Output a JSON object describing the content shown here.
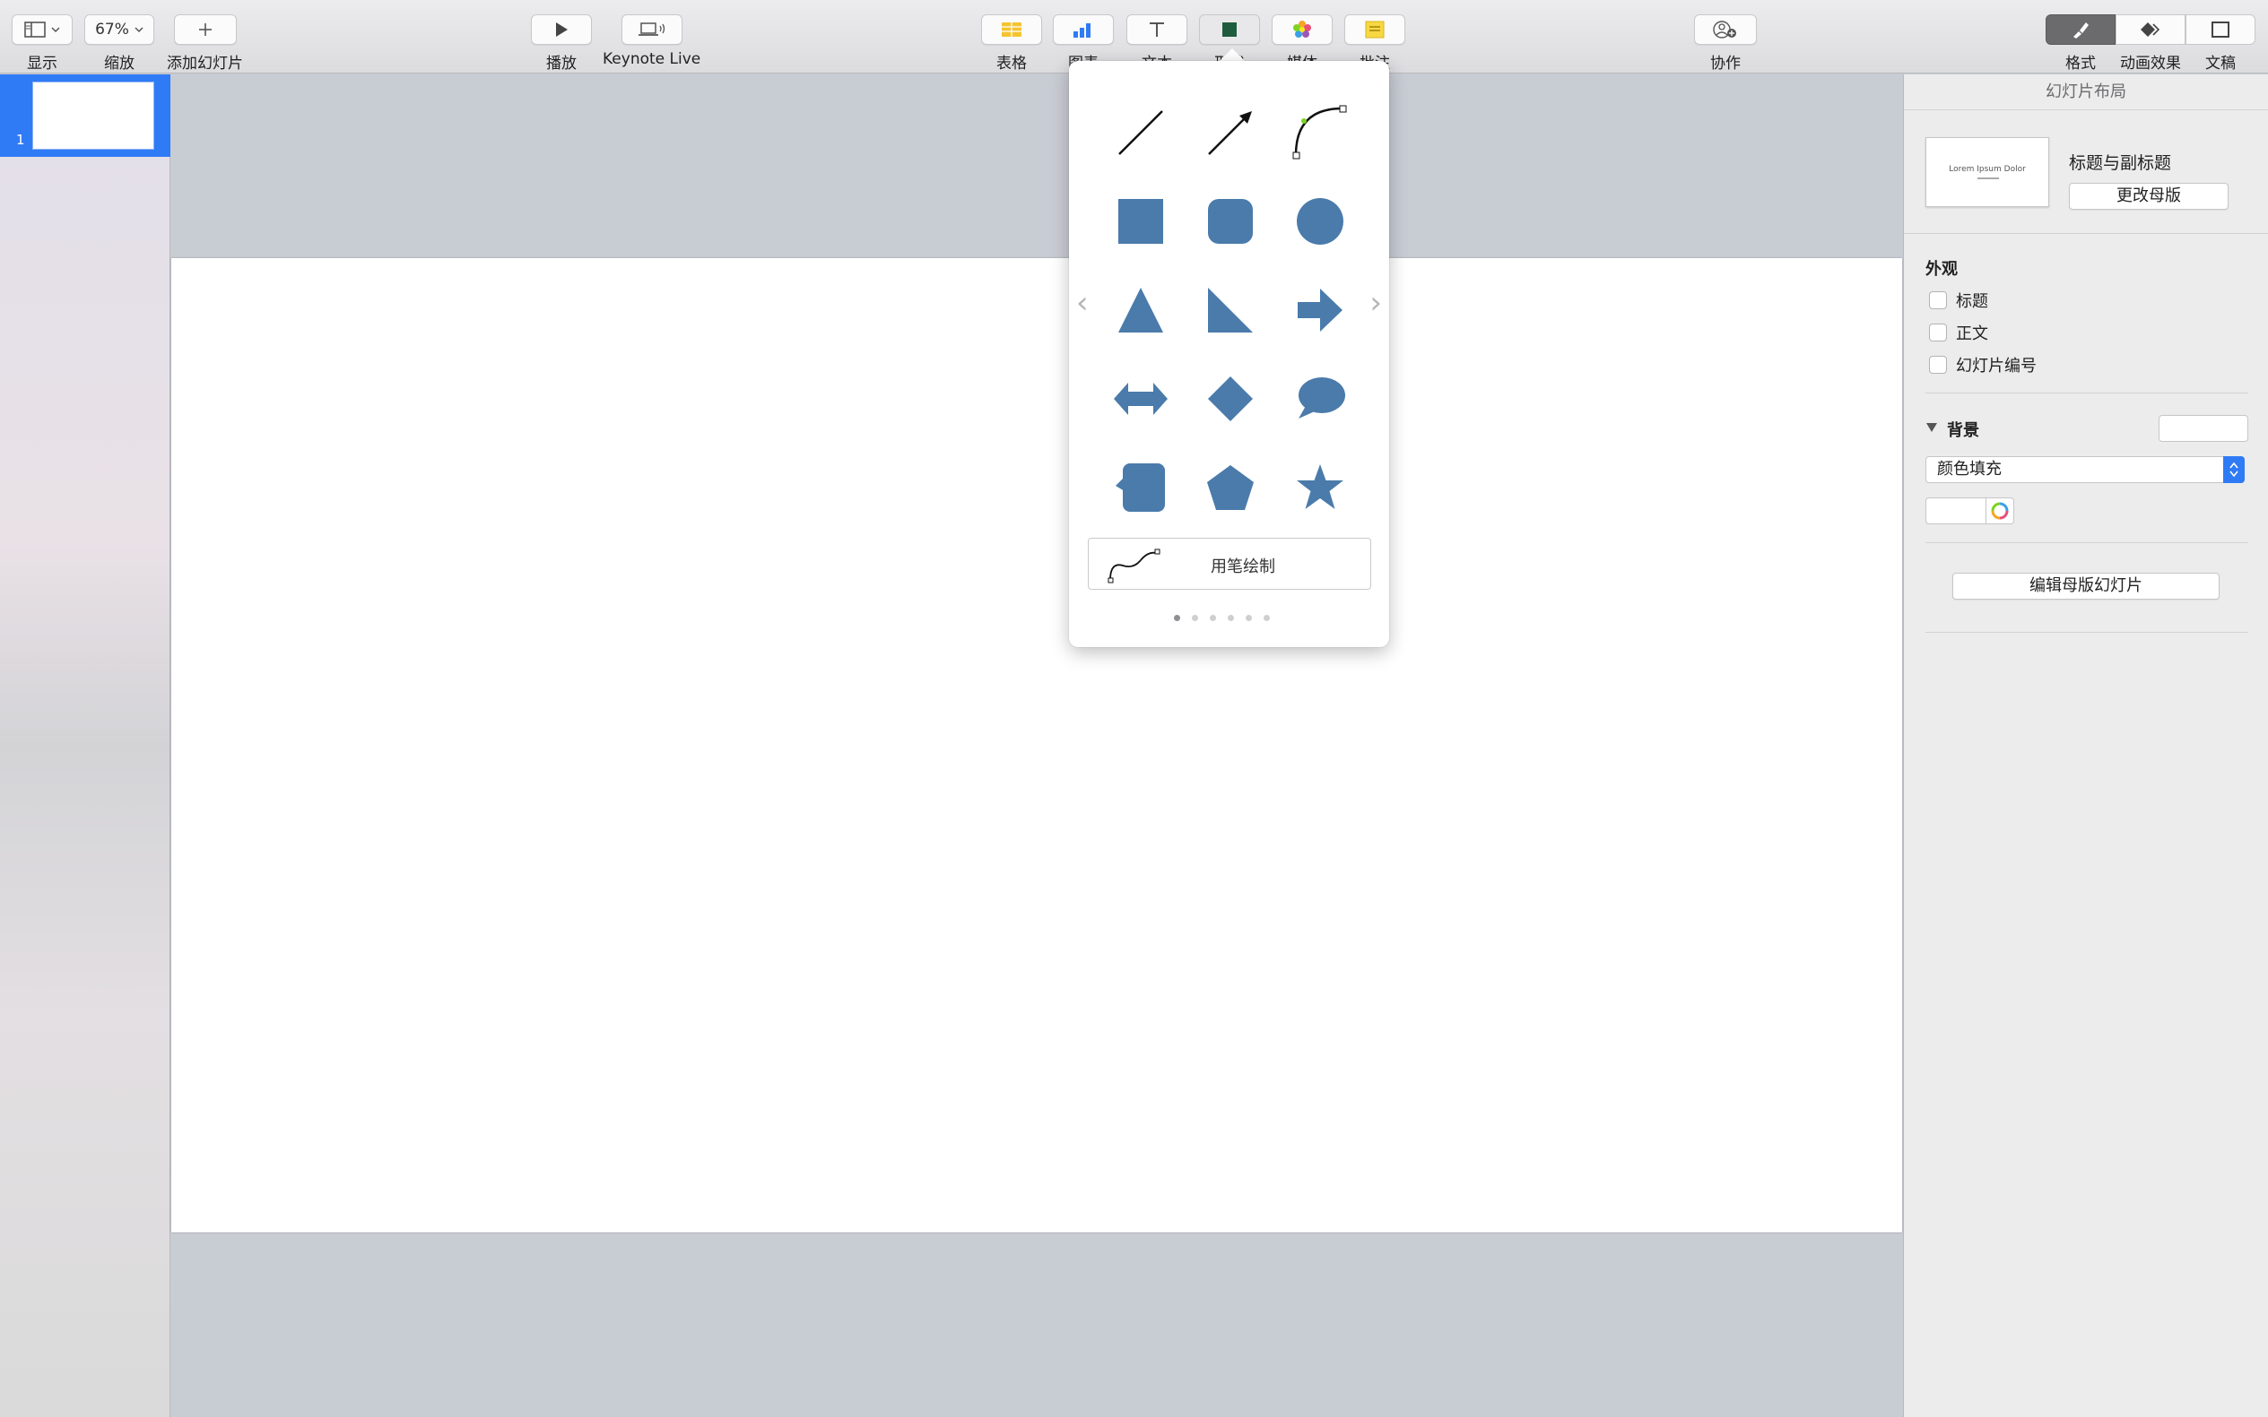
{
  "toolbar": {
    "view_label": "显示",
    "zoom_value": "67%",
    "zoom_label": "缩放",
    "add_slide_label": "添加幻灯片",
    "play_label": "播放",
    "keynote_live_label": "Keynote Live",
    "table_label": "表格",
    "chart_label": "图表",
    "text_label": "文本",
    "shape_label": "形状",
    "media_label": "媒体",
    "comment_label": "批注",
    "collaborate_label": "协作",
    "format_label": "格式",
    "animate_label": "动画效果",
    "document_label": "文稿"
  },
  "navigator": {
    "slide_number": "1"
  },
  "shape_popover": {
    "draw_label": "用笔绘制",
    "page_count": 6,
    "current_page": 1,
    "shape_color": "#4a7bab"
  },
  "inspector": {
    "header": "幻灯片布局",
    "layout_thumb_text": "Lorem Ipsum Dolor",
    "layout_name": "标题与副标题",
    "change_master_label": "更改母版",
    "appearance_title": "外观",
    "checkbox_title": "标题",
    "checkbox_body": "正文",
    "checkbox_slide_number": "幻灯片编号",
    "background_title": "背景",
    "fill_select_value": "颜色填充",
    "edit_master_label": "编辑母版幻灯片"
  },
  "colors": {
    "accent": "#2f7bf5",
    "shape": "#4a7bab"
  }
}
